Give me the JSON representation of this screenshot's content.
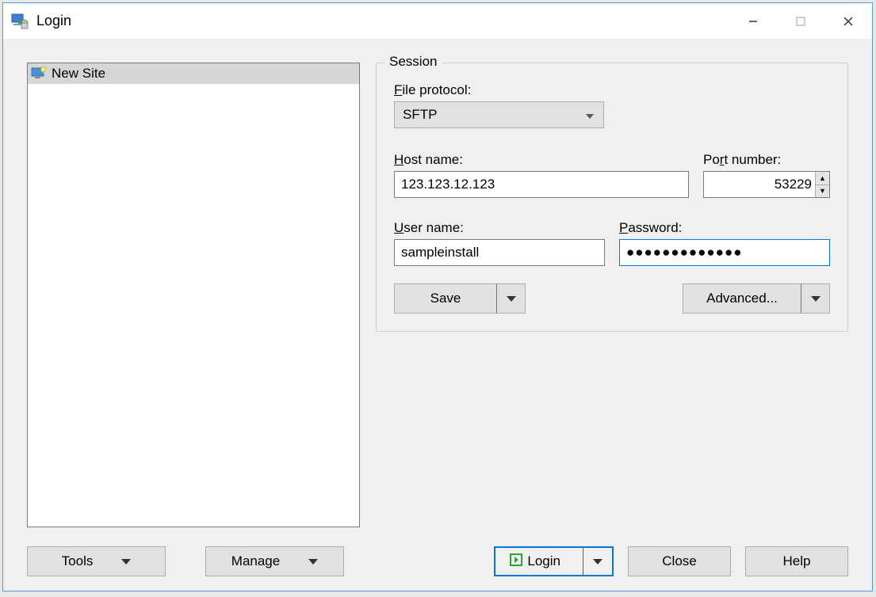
{
  "window": {
    "title": "Login"
  },
  "sites": {
    "new_site_label": "New Site"
  },
  "session": {
    "group_title": "Session",
    "protocol_label": "File protocol:",
    "protocol_value": "SFTP",
    "host_label": "Host name:",
    "host_value": "123.123.12.123",
    "port_label": "Port number:",
    "port_value": "53229",
    "user_label": "User name:",
    "user_value": "sampleinstall",
    "password_label": "Password:",
    "password_masked": "●●●●●●●●●●●●●",
    "save_label": "Save",
    "advanced_label": "Advanced..."
  },
  "bottom": {
    "tools_label": "Tools",
    "manage_label": "Manage",
    "login_label": "Login",
    "close_label": "Close",
    "help_label": "Help"
  }
}
